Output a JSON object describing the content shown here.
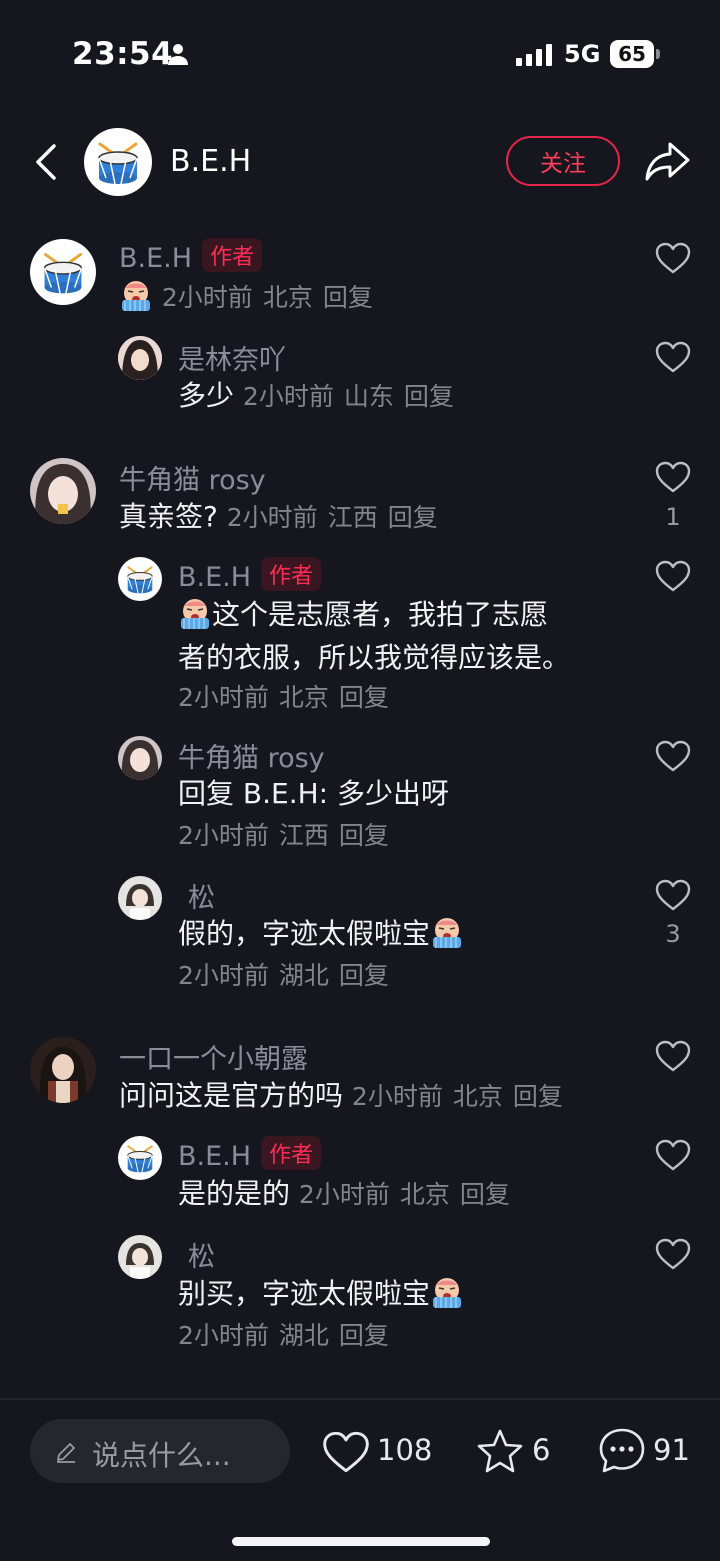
{
  "status_bar": {
    "time": "23:54",
    "network": "5G",
    "battery": "65"
  },
  "header": {
    "title": "B.E.H",
    "follow_label": "关注"
  },
  "comments": [
    {
      "name": "B.E.H",
      "tag": "作者",
      "text": "",
      "time": "2小时前",
      "location": "北京",
      "reply": "回复",
      "likes": "",
      "replies": [
        {
          "name": "是林奈吖",
          "tag": "",
          "text": "多少",
          "time": "2小时前",
          "location": "山东",
          "reply": "回复",
          "likes": ""
        }
      ]
    },
    {
      "name": "牛角猫 rosy",
      "tag": "",
      "text": "真亲签?",
      "time": "2小时前",
      "location": "江西",
      "reply": "回复",
      "likes": "1",
      "replies": [
        {
          "name": "B.E.H",
          "tag": "作者",
          "text_line1": "这个是志愿者，我拍了志愿",
          "text_line2": "者的衣服，所以我觉得应该是。",
          "time": "2小时前",
          "location": "北京",
          "reply": "回复",
          "likes": ""
        },
        {
          "name": "牛角猫 rosy",
          "tag": "",
          "text": "回复 B.E.H: 多少出呀",
          "time": "2小时前",
          "location": "江西",
          "reply": "回复",
          "likes": ""
        },
        {
          "name": "松",
          "tag": "",
          "text": "假的，字迹太假啦宝",
          "time": "2小时前",
          "location": "湖北",
          "reply": "回复",
          "likes": "3"
        }
      ]
    },
    {
      "name": "一口一个小朝露",
      "tag": "",
      "text": "问问这是官方的吗",
      "time": "2小时前",
      "location": "北京",
      "reply": "回复",
      "likes": "",
      "replies": [
        {
          "name": "B.E.H",
          "tag": "作者",
          "text": "是的是的",
          "time": "2小时前",
          "location": "北京",
          "reply": "回复",
          "likes": ""
        },
        {
          "name": "松",
          "tag": "",
          "text": "别买，字迹太假啦宝",
          "time": "2小时前",
          "location": "湖北",
          "reply": "回复",
          "likes": ""
        }
      ]
    }
  ],
  "bottom_bar": {
    "placeholder": "说点什么...",
    "likes": "108",
    "favorites": "6",
    "comments": "91"
  },
  "colors": {
    "background": "#16161e",
    "accent": "#fe2c55",
    "muted_text": "#8c8c96"
  }
}
